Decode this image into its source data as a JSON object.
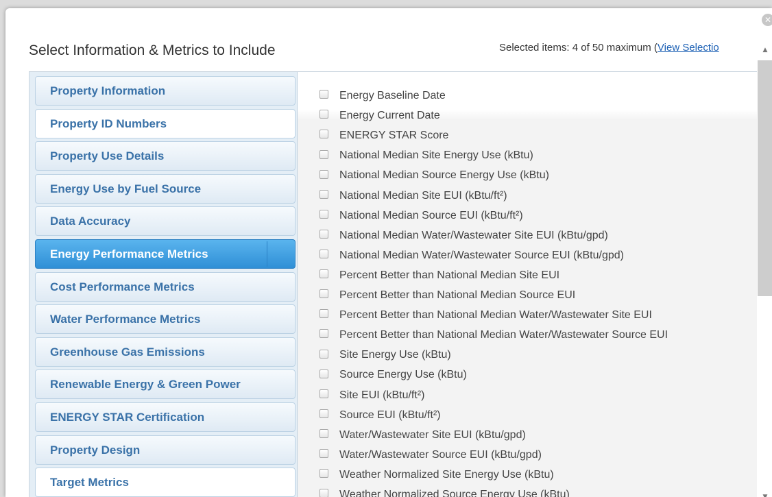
{
  "dialog": {
    "title": "Select Information & Metrics to Include",
    "selected_count_text": "Selected items: 4 of 50 maximum (",
    "view_selection_link": "View Selectio",
    "close_glyph": "✕",
    "scroll_up_glyph": "▲",
    "scroll_down_glyph": "▼"
  },
  "categories": [
    {
      "label": "Property Information"
    },
    {
      "label": "Property ID Numbers"
    },
    {
      "label": "Property Use Details"
    },
    {
      "label": "Energy Use by Fuel Source"
    },
    {
      "label": "Data Accuracy"
    },
    {
      "label": "Energy Performance Metrics",
      "active": true
    },
    {
      "label": "Cost Performance Metrics"
    },
    {
      "label": "Water Performance Metrics"
    },
    {
      "label": "Greenhouse Gas Emissions"
    },
    {
      "label": "Renewable Energy & Green Power"
    },
    {
      "label": "ENERGY STAR Certification"
    },
    {
      "label": "Property Design"
    },
    {
      "label": "Target Metrics"
    }
  ],
  "metrics": [
    "Energy Baseline Date",
    "Energy Current Date",
    "ENERGY STAR Score",
    "National Median Site Energy Use (kBtu)",
    "National Median Source Energy Use (kBtu)",
    "National Median Site EUI (kBtu/ft²)",
    "National Median Source EUI (kBtu/ft²)",
    "National Median Water/Wastewater Site EUI (kBtu/gpd)",
    "National Median Water/Wastewater Source EUI (kBtu/gpd)",
    "Percent Better than National Median Site EUI",
    "Percent Better than National Median Source EUI",
    "Percent Better than National Median Water/Wastewater Site EUI",
    "Percent Better than National Median Water/Wastewater Source EUI",
    "Site Energy Use (kBtu)",
    "Source Energy Use (kBtu)",
    "Site EUI (kBtu/ft²)",
    "Source EUI (kBtu/ft²)",
    "Water/Wastewater Site EUI (kBtu/gpd)",
    "Water/Wastewater Source EUI (kBtu/gpd)",
    "Weather Normalized Site Energy Use (kBtu)",
    "Weather Normalized Source Energy Use (kBtu)"
  ],
  "colors": {
    "category_text": "#3a72a8",
    "active_category_bg": "#3a9ee2",
    "link": "#1a5fb4"
  }
}
